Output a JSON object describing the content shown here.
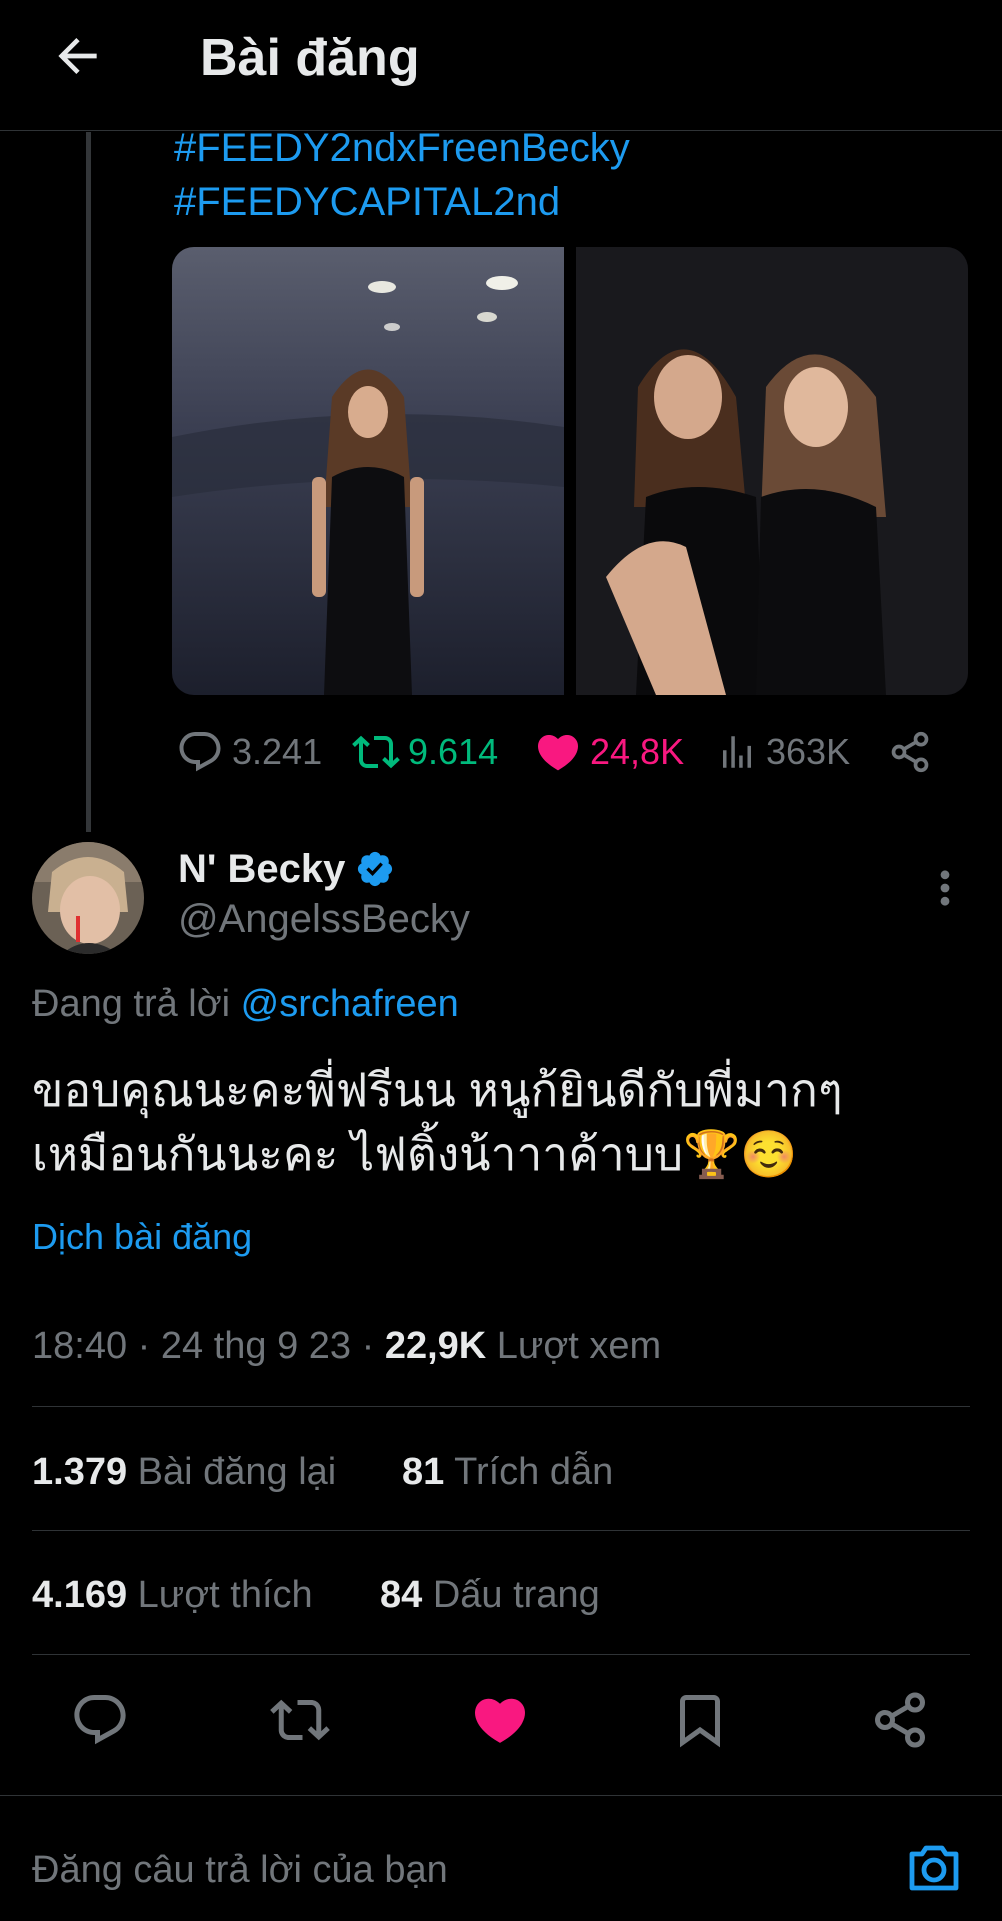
{
  "header": {
    "title": "Bài đăng"
  },
  "quoted_post": {
    "hashtags": [
      "#FEEDY2ndxFreenBecky",
      "#FEEDYCAPITAL2nd"
    ],
    "stats": {
      "replies": "3.241",
      "reposts": "9.614",
      "likes": "24,8K",
      "views": "363K"
    }
  },
  "post": {
    "author_name": "N' Becky",
    "handle": "@AngelssBecky",
    "replying_prefix": "Đang trả lời",
    "replying_to": "@srchafreen",
    "text_line1": "ขอบคุณนะคะพี่ฟรีนน หนูก้ยินดีกับพี่มากๆ",
    "text_line2": "เหมือนกันนะคะ ไฟติ้งน้าาาค้าบบ🏆☺️",
    "translate_label": "Dịch bài đăng",
    "time": "18:40",
    "date": "24 thg 9 23",
    "views_count": "22,9K",
    "views_label": "Lượt xem",
    "reposts_count": "1.379",
    "reposts_label": "Bài đăng lại",
    "quotes_count": "81",
    "quotes_label": "Trích dẫn",
    "likes_count": "4.169",
    "likes_label": "Lượt thích",
    "bookmarks_count": "84",
    "bookmarks_label": "Dấu trang"
  },
  "reply_bar": {
    "placeholder": "Đăng câu trả lời của bạn"
  },
  "colors": {
    "accent": "#1d9bf0",
    "like": "#f91880",
    "repost": "#00ba7c",
    "muted": "#71767b",
    "background": "#000000"
  },
  "icons": [
    "back-arrow-icon",
    "reply-icon",
    "repost-icon",
    "heart-icon",
    "views-icon",
    "share-icon",
    "verified-icon",
    "more-icon",
    "bookmark-icon",
    "camera-icon"
  ]
}
